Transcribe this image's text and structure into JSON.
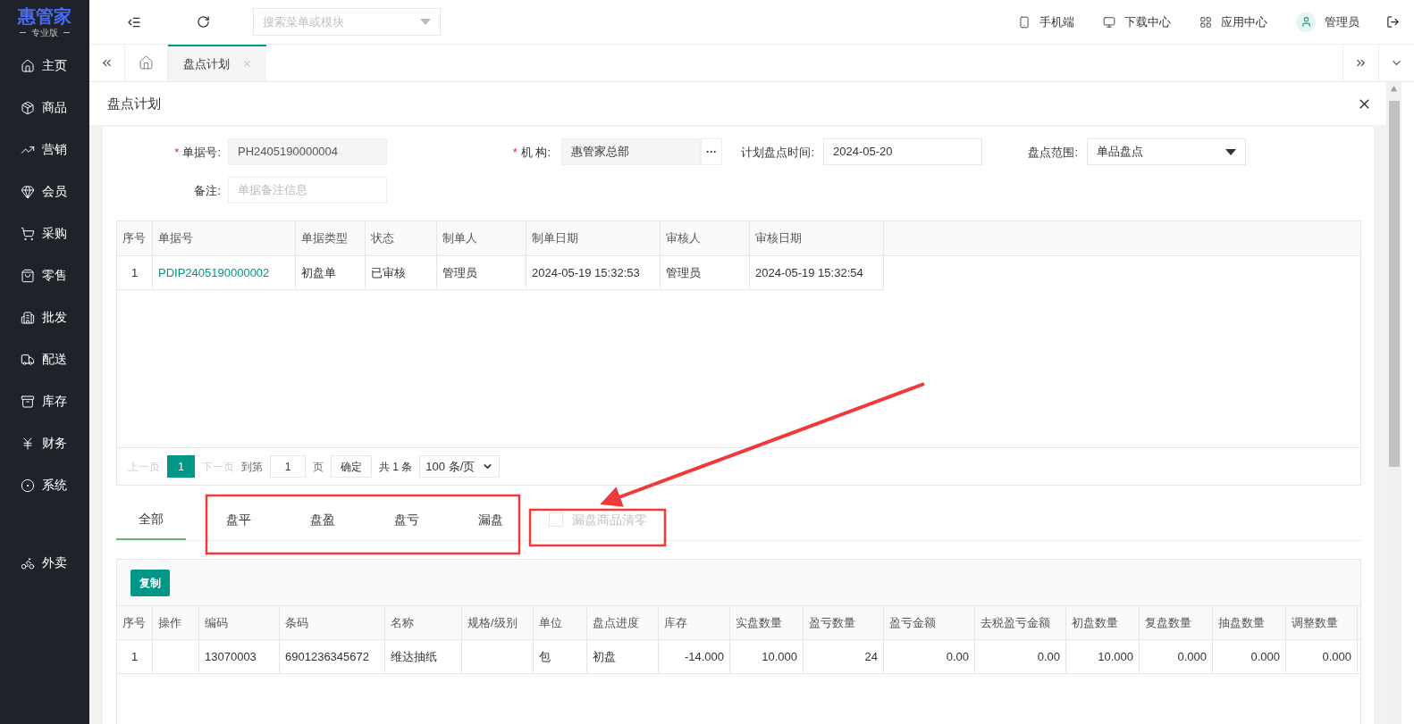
{
  "logo": {
    "name": "惠管家",
    "edition": "专业版"
  },
  "sidebar": {
    "items": [
      {
        "label": "主页"
      },
      {
        "label": "商品"
      },
      {
        "label": "营销"
      },
      {
        "label": "会员"
      },
      {
        "label": "采购"
      },
      {
        "label": "零售"
      },
      {
        "label": "批发"
      },
      {
        "label": "配送"
      },
      {
        "label": "库存"
      },
      {
        "label": "财务"
      },
      {
        "label": "系统"
      }
    ],
    "extra_items": [
      {
        "label": "外卖"
      }
    ]
  },
  "header": {
    "search": {
      "placeholder": "搜索菜单或模块"
    },
    "links": [
      "手机端",
      "下载中心",
      "应用中心"
    ],
    "user": "管理员"
  },
  "page_tabs": [
    {
      "label": "盘点计划",
      "selected": true
    }
  ],
  "page_title": "盘点计划",
  "form": {
    "doc_no": {
      "label": "单据号:",
      "required_mark": "*",
      "value": "PH2405190000004"
    },
    "org": {
      "label": "机 构:",
      "required_mark": "*",
      "value": "惠管家总部",
      "button": "···"
    },
    "plan_date": {
      "label": "计划盘点时间:",
      "value": "2024-05-20"
    },
    "scope": {
      "label": "盘点范围:",
      "value": "单品盘点"
    },
    "remark": {
      "label": "备注:",
      "placeholder": "单据备注信息"
    }
  },
  "orders_table": {
    "columns": [
      "序号",
      "单据号",
      "单据类型",
      "状态",
      "制单人",
      "制单日期",
      "审核人",
      "审核日期"
    ],
    "rows": [
      [
        "1",
        "PDIP2405190000002",
        "初盘单",
        "已审核",
        "管理员",
        "2024-05-19 15:32:53",
        "管理员",
        "2024-05-19 15:32:54"
      ]
    ]
  },
  "pagination": {
    "prev": "上一页",
    "pages": [
      {
        "label": "1",
        "selected": true
      }
    ],
    "next": "下一页",
    "goto_label": "到第",
    "goto_value": "1",
    "page_unit": "页",
    "confirm": "确定",
    "total": "共 1 条",
    "page_size": "100 条/页"
  },
  "result_tabs": [
    {
      "label": "全部",
      "selected": true
    },
    {
      "label": "盘平",
      "selected": false
    },
    {
      "label": "盘盈",
      "selected": false
    },
    {
      "label": "盘亏",
      "selected": false
    },
    {
      "label": "漏盘",
      "selected": false
    }
  ],
  "clear_missing": {
    "label": "漏盘商品清零",
    "checked": false,
    "disabled": true
  },
  "copy_button": "复制",
  "items_table": {
    "columns": [
      "序号",
      "操作",
      "编码",
      "条码",
      "名称",
      "规格/级别",
      "单位",
      "盘点进度",
      "库存",
      "实盘数量",
      "盈亏数量",
      "盈亏金额",
      "去税盈亏金额",
      "初盘数量",
      "复盘数量",
      "抽盘数量",
      "调整数量"
    ],
    "rows": [
      [
        "1",
        "",
        "13070003",
        "6901236345672",
        "维达抽纸",
        "",
        "包",
        "初盘",
        "-14.000",
        "10.000",
        "24",
        "0.00",
        "0.00",
        "10.000",
        "0.000",
        "0.000",
        "0.000"
      ]
    ]
  }
}
